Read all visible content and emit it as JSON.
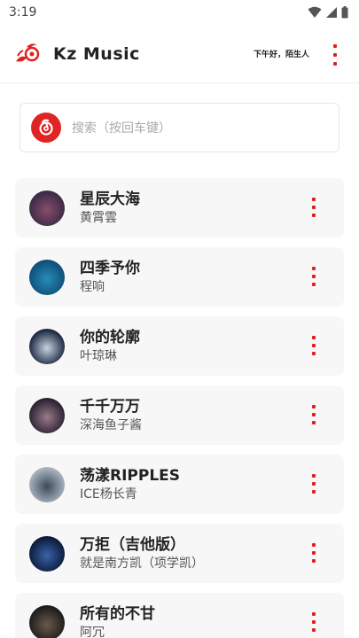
{
  "status_bar": {
    "time": "3:19",
    "icons": [
      "wifi-icon",
      "cell-signal-icon",
      "battery-icon"
    ]
  },
  "header": {
    "title": "Kz Music",
    "greeting": "下午好，陌生人",
    "accent": "#e02020"
  },
  "search": {
    "placeholder": "搜索（按回车键）"
  },
  "songs": [
    {
      "title": "星辰大海",
      "artist": "黄霄雲",
      "cover_colors": [
        "#3a2b47",
        "#8a4b6b"
      ]
    },
    {
      "title": "四季予你",
      "artist": "程响",
      "cover_colors": [
        "#0d4f7a",
        "#2a8bb8"
      ]
    },
    {
      "title": "你的轮廓",
      "artist": "叶琼琳",
      "cover_colors": [
        "#1a2740",
        "#c9d3e0"
      ]
    },
    {
      "title": "千千万万",
      "artist": "深海鱼子酱",
      "cover_colors": [
        "#2a2230",
        "#9a7a8a"
      ]
    },
    {
      "title": "荡漾RIPPLES",
      "artist": "ICE杨长青",
      "cover_colors": [
        "#a9b4bf",
        "#3c4a58"
      ]
    },
    {
      "title": "万拒（吉他版）",
      "artist": "就是南方凯（项学凯）",
      "cover_colors": [
        "#0c1a3a",
        "#3a63a8"
      ]
    },
    {
      "title": "所有的不甘",
      "artist": "阿冗",
      "cover_colors": [
        "#1c1c1c",
        "#6a5a4a"
      ]
    }
  ]
}
